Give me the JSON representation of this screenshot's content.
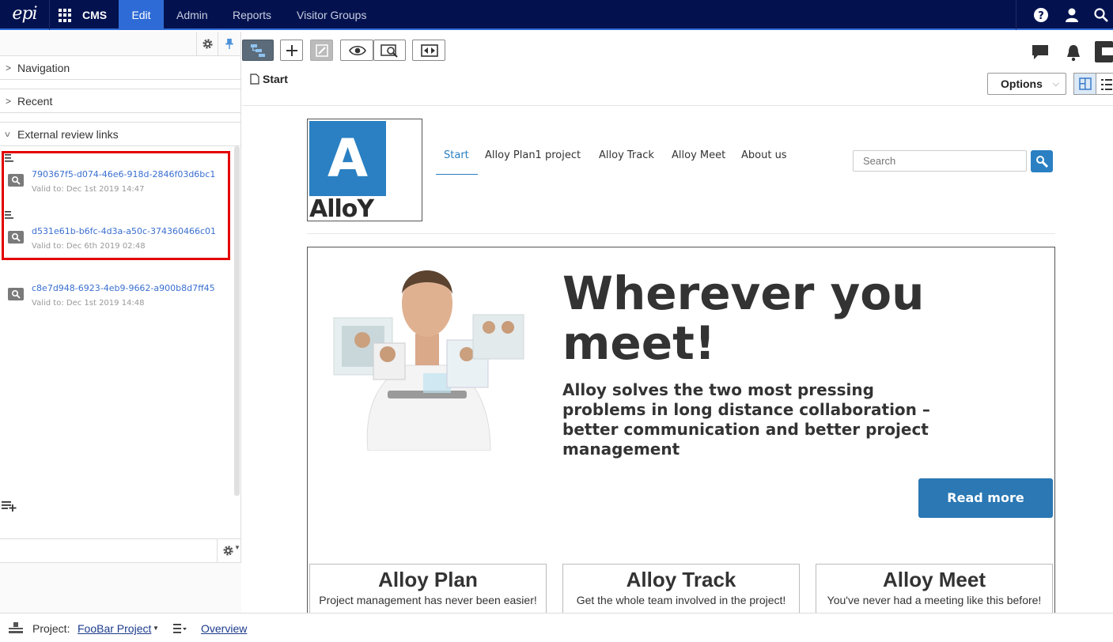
{
  "topbar": {
    "logo": "epi",
    "product": "CMS",
    "tabs": [
      "Edit",
      "Admin",
      "Reports",
      "Visitor Groups"
    ]
  },
  "left_pane": {
    "sections": {
      "navigation": "Navigation",
      "recent": "Recent",
      "external_review": "External review links"
    },
    "review_links": [
      {
        "id": "790367f5-d074-46e6-918d-2846f03d6bc1",
        "valid": "Valid to: Dec 1st 2019 14:47"
      },
      {
        "id": "d531e61b-b6fc-4d3a-a50c-374360466c01",
        "valid": "Valid to: Dec 6th 2019 02:48"
      },
      {
        "id": "c8e7d948-6923-4eb9-9662-a900b8d7ff45",
        "valid": "Valid to: Dec 1st 2019 14:48"
      }
    ]
  },
  "toolbar": {
    "breadcrumb": "Start",
    "options_label": "Options"
  },
  "site": {
    "logo_letter": "A",
    "logo_word": "AlloY",
    "nav": [
      "Start",
      "Alloy Plan1 project",
      "Alloy Track",
      "Alloy Meet",
      "About us"
    ],
    "search_placeholder": "Search",
    "hero_title": "Wherever you meet!",
    "hero_text": "Alloy solves the two most pressing problems in long distance collaboration – better communication and better project management",
    "read_more": "Read more",
    "cards": [
      {
        "title": "Alloy Plan",
        "subtitle": "Project management has never been easier!"
      },
      {
        "title": "Alloy Track",
        "subtitle": "Get the whole team involved in the project!"
      },
      {
        "title": "Alloy Meet",
        "subtitle": "You've never had a meeting like this before!"
      }
    ]
  },
  "statusbar": {
    "project_label": "Project:",
    "project_name": "FooBar Project",
    "overview": "Overview"
  },
  "colors": {
    "topbar_bg": "#03124f",
    "accent": "#2f6bd6",
    "alloy_blue": "#2a80c2",
    "highlight_red": "#e30000"
  }
}
